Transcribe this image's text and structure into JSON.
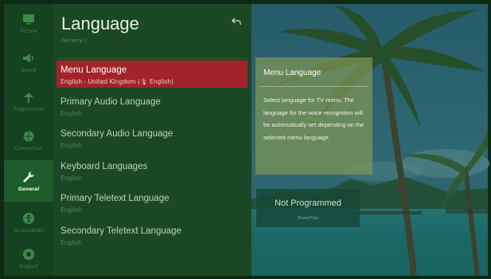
{
  "rail": [
    {
      "label": "Picture",
      "icon": "picture-icon"
    },
    {
      "label": "Sound",
      "icon": "speaker-icon"
    },
    {
      "label": "Programmes",
      "icon": "antenna-icon"
    },
    {
      "label": "Connection",
      "icon": "globe-icon"
    },
    {
      "label": "General",
      "icon": "wrench-icon",
      "active": true
    },
    {
      "label": "Accessibility",
      "icon": "accessibility-icon"
    },
    {
      "label": "Support",
      "icon": "support-icon"
    }
  ],
  "panel": {
    "title": "Language",
    "breadcrumb": "General /",
    "items": [
      {
        "label": "Menu Language",
        "value": "English - United Kingdom (🎙 English)",
        "selected": true
      },
      {
        "label": "Primary Audio Language",
        "value": "English"
      },
      {
        "label": "Secondary Audio Language",
        "value": "English"
      },
      {
        "label": "Keyboard Languages",
        "value": "English"
      },
      {
        "label": "Primary Teletext Language",
        "value": "English"
      },
      {
        "label": "Secondary Teletext Language",
        "value": "English"
      }
    ]
  },
  "help": {
    "title": "Menu Language",
    "body": "Select language for TV menu. The language for the voice recognition will be automatically set depending on the selected menu language."
  },
  "preview": {
    "status": "Not Programmed",
    "hint": "Show/Hide"
  },
  "colors": {
    "selected": "#a2232a",
    "panel": "#1a4824",
    "rail": "#15421f"
  }
}
